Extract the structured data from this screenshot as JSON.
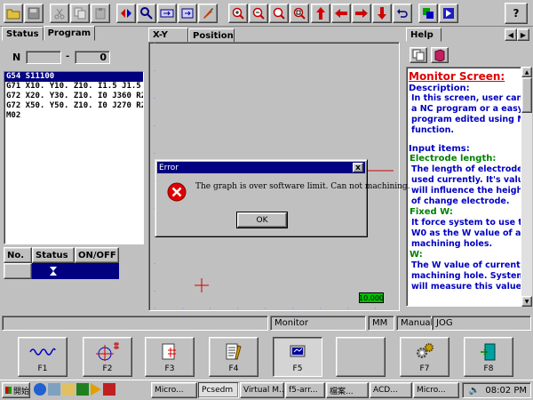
{
  "toolbar": {
    "help_label": "?"
  },
  "left_panel": {
    "tabs": [
      {
        "label": "Status"
      },
      {
        "label": "Program"
      }
    ],
    "n_label": "N",
    "n_dash": "-",
    "n_value2": "0",
    "program_lines": [
      "G54 S11100",
      "G71 X10. Y10. Z10. I1.5 J1.5 K1 U2",
      "G72 X20. Y30. Z10. I0 J360 R2.5 K",
      "G72 X50. Y50. Z10. I0 J270 R2.5 K",
      "M02"
    ],
    "status_table": {
      "headers": [
        "No.",
        "Status",
        "ON/OFF"
      ]
    }
  },
  "middle_panel": {
    "tabs": [
      {
        "label": "X-Y"
      },
      {
        "label": "Position"
      }
    ],
    "zoom_readout": "10.000"
  },
  "help_panel": {
    "tab_label": "Help",
    "title": "Monitor Screen:",
    "description_heading": "Description:",
    "description_lines": [
      "In this screen, user can r",
      "a NC program or a easy",
      "program edited using Mi",
      "function."
    ],
    "input_heading": "Input items:",
    "items": [
      {
        "name": "Electrode length:",
        "lines": [
          "The length of electrode",
          "used currently.  It's valu",
          "will influence the heigh",
          "of change electrode."
        ]
      },
      {
        "name": "Fixed W:",
        "lines": [
          "It force system to use th",
          "W0 as the W value of al",
          "machining holes."
        ]
      },
      {
        "name": "W:",
        "lines": [
          "The W value of current",
          "machining hole. System",
          "will measure this value"
        ]
      }
    ]
  },
  "status_bar": {
    "monitor": "Monitor",
    "unit": "MM",
    "mode": "Manual",
    "jog": "JOG"
  },
  "function_keys": [
    {
      "label": "F1",
      "icon": "wave-icon"
    },
    {
      "label": "F2",
      "icon": "crosshair-icon"
    },
    {
      "label": "F3",
      "icon": "document-grid-icon"
    },
    {
      "label": "F4",
      "icon": "notepad-icon"
    },
    {
      "label": "F5",
      "icon": "monitor-icon"
    },
    {
      "label": "",
      "icon": ""
    },
    {
      "label": "F7",
      "icon": "gears-icon"
    },
    {
      "label": "F8",
      "icon": "exit-door-icon"
    }
  ],
  "taskbar": {
    "start_label": "開始",
    "tasks": [
      {
        "label": "Micro..."
      },
      {
        "label": "Pcsedm"
      },
      {
        "label": "Virtual M..."
      },
      {
        "label": "f5-arr..."
      },
      {
        "label": "檔案..."
      },
      {
        "label": "ACD..."
      },
      {
        "label": "Micro..."
      }
    ],
    "clock": "08:02 PM"
  },
  "dialog": {
    "title": "Error",
    "close_label": "x",
    "message": "The graph is over software limit. Can not machining.",
    "ok_label": "OK"
  },
  "colors": {
    "selection": "#000080",
    "help_title": "#e00000",
    "help_text": "#0000c0",
    "help_subheading": "#008000",
    "zoom_readout_bg": "#00c000"
  }
}
